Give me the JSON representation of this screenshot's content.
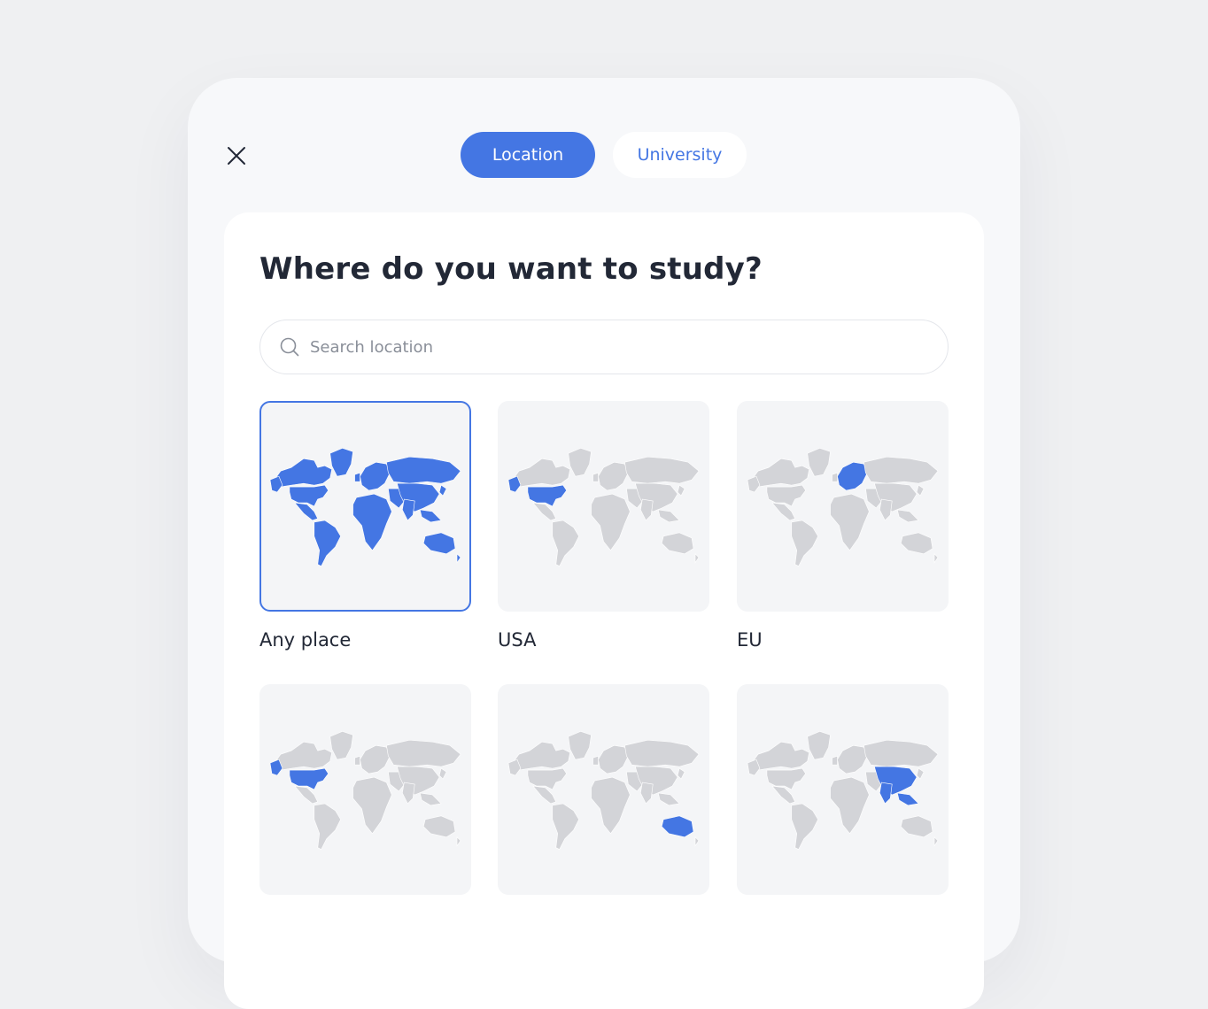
{
  "tabs": [
    {
      "label": "Location",
      "active": true
    },
    {
      "label": "University",
      "active": false
    }
  ],
  "title": "Where do you want to study?",
  "search": {
    "placeholder": "Search location",
    "value": ""
  },
  "regions": [
    {
      "label": "Any place",
      "selected": true,
      "highlight": "world"
    },
    {
      "label": "USA",
      "selected": false,
      "highlight": "usa"
    },
    {
      "label": "EU",
      "selected": false,
      "highlight": "eu"
    },
    {
      "label": "",
      "selected": false,
      "highlight": "usa"
    },
    {
      "label": "",
      "selected": false,
      "highlight": "australia"
    },
    {
      "label": "",
      "selected": false,
      "highlight": "asia"
    }
  ],
  "colors": {
    "accent": "#4476e3",
    "map_inactive": "#d3d4d8",
    "map_active": "#4476e3"
  },
  "icons": {
    "close": "close-icon",
    "search": "search-icon",
    "map": "world-map-icon"
  }
}
